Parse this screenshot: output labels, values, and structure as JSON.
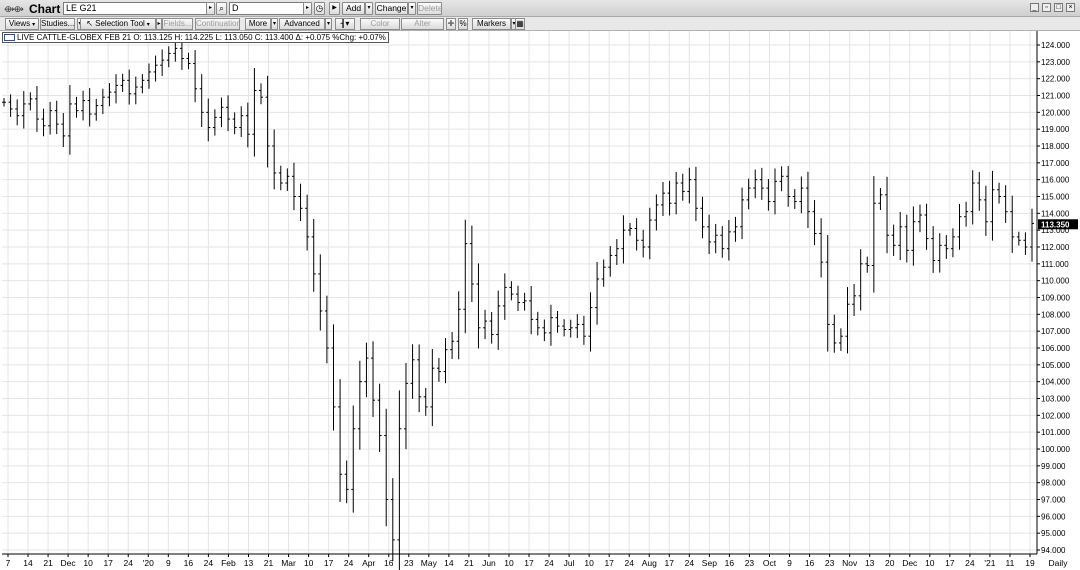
{
  "window": {
    "title": "Chart",
    "symbol": "LE G21",
    "interval": "D",
    "buttons": {
      "add": "Add",
      "change": "Change",
      "delete": "Delete"
    }
  },
  "toolbar": {
    "views": "Views",
    "studies": "Studies...",
    "selection_tool": "Selection Tool",
    "fields": "Fields...",
    "continuation": "Continuation",
    "more": "More",
    "advanced": "Advanced",
    "color": "Color",
    "alter": "Alter",
    "percent": "%",
    "markers": "Markers"
  },
  "info": {
    "text": "LIVE CATTLE-GLOBEX FEB 21  O: 113.125  H: 114.225  L: 113.050  C: 113.400  Δ: +0.075  %Chg: +0.07%"
  },
  "colors": {
    "bar": "#000000",
    "grid": "#e4e4e4",
    "last_price_bg": "#000000",
    "accent": "#2a4f9e"
  },
  "chart_data": {
    "type": "ohlc_bar",
    "title": "",
    "ylim": [
      94,
      124.8
    ],
    "y_ticks": [
      "94.000",
      "95.000",
      "96.000",
      "97.000",
      "98.000",
      "99.000",
      "100.000",
      "101.000",
      "102.000",
      "103.000",
      "104.000",
      "105.000",
      "106.000",
      "107.000",
      "108.000",
      "109.000",
      "110.000",
      "111.000",
      "112.000",
      "113.000",
      "114.000",
      "115.000",
      "116.000",
      "117.000",
      "118.000",
      "119.000",
      "120.000",
      "121.000",
      "122.000",
      "123.000",
      "124.000"
    ],
    "x_ticks": [
      "7",
      "14",
      "21",
      "Dec",
      "10",
      "17",
      "24",
      "'20",
      "9",
      "16",
      "24",
      "Feb",
      "13",
      "21",
      "Mar",
      "10",
      "17",
      "24",
      "Apr",
      "16",
      "23",
      "May",
      "14",
      "21",
      "Jun",
      "10",
      "17",
      "24",
      "Jul",
      "10",
      "17",
      "24",
      "Aug",
      "17",
      "24",
      "Sep",
      "16",
      "23",
      "Oct",
      "9",
      "16",
      "23",
      "Nov",
      "13",
      "20",
      "Dec",
      "10",
      "17",
      "24",
      "'21",
      "11",
      "19"
    ],
    "x_axis_mode": "Daily",
    "last_price": "113.350",
    "closes": [
      120.6,
      120.2,
      119.8,
      120.5,
      120.8,
      119.6,
      119.2,
      120.1,
      119.3,
      118.6,
      120.5,
      120.1,
      120.7,
      119.9,
      120.4,
      120.9,
      121.2,
      121.6,
      121.9,
      121.1,
      121.5,
      121.9,
      122.4,
      122.8,
      123.1,
      123.5,
      123.8,
      123.2,
      122.9,
      121.4,
      120.0,
      119.1,
      119.7,
      120.3,
      119.6,
      119.1,
      119.8,
      118.7,
      121.3,
      120.9,
      118.0,
      116.4,
      115.8,
      116.2,
      115.0,
      114.3,
      112.6,
      110.4,
      108.2,
      106.0,
      102.5,
      98.5,
      97.6,
      101.2,
      104.0,
      105.4,
      102.9,
      100.8,
      97.0,
      94.6,
      101.2,
      103.9,
      105.3,
      103.1,
      102.5,
      104.8,
      104.6,
      105.9,
      106.4,
      108.3,
      112.2,
      109.8,
      107.2,
      107.6,
      106.8,
      108.5,
      109.6,
      109.2,
      108.7,
      108.8,
      107.7,
      107.2,
      106.9,
      107.8,
      107.3,
      107.1,
      107.2,
      107.4,
      106.7,
      108.4,
      110.1,
      110.8,
      111.5,
      111.9,
      113.0,
      113.1,
      112.4,
      112.0,
      113.6,
      114.5,
      115.2,
      114.6,
      115.8,
      115.3,
      116.0,
      114.3,
      113.2,
      112.3,
      112.7,
      111.9,
      112.9,
      113.2,
      114.8,
      115.5,
      116.0,
      115.5,
      114.7,
      115.9,
      116.2,
      115.0,
      114.7,
      115.5,
      114.1,
      112.8,
      111.1,
      107.4,
      106.3,
      106.7,
      108.6,
      109.1,
      111.0,
      110.9,
      114.6,
      115.1,
      112.7,
      112.1,
      113.2,
      111.8,
      113.5,
      113.9,
      112.5,
      111.2,
      112.1,
      111.9,
      112.6,
      113.8,
      114.1,
      115.8,
      114.8,
      113.5,
      115.4,
      115.0,
      114.1,
      112.6,
      112.4,
      112.0,
      113.4
    ]
  }
}
